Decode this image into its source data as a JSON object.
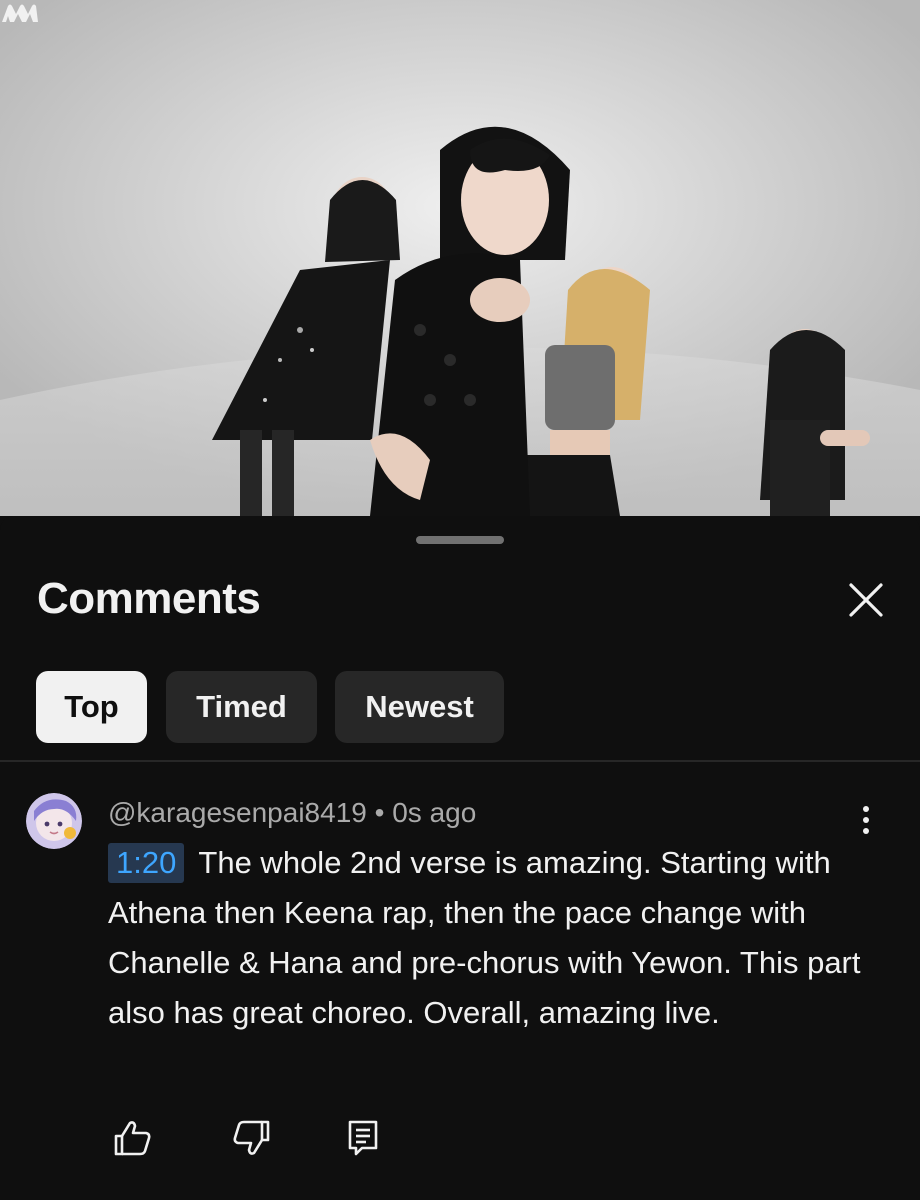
{
  "app": {
    "logo_icon": "youtube-music-style-m-logo"
  },
  "comments_sheet": {
    "title": "Comments",
    "close_icon": "close-icon",
    "tabs": [
      {
        "label": "Top",
        "active": true
      },
      {
        "label": "Timed",
        "active": false
      },
      {
        "label": "Newest",
        "active": false
      }
    ],
    "comment": {
      "author": "@karagesenpai8419",
      "separator": " • ",
      "time_ago": "0s ago",
      "timestamp": "1:20",
      "text": "The whole 2nd verse is amazing. Starting with Athena then Keena rap, then the pace change with Chanelle & Hana and pre-chorus with Yewon. This part also has great choreo. Overall, amazing live.",
      "actions": [
        "like-icon",
        "dislike-icon",
        "reply-icon"
      ],
      "menu_icon": "more-vert-icon"
    }
  },
  "colors": {
    "background": "#0f0f0f",
    "chip_active": "#f1f1f1",
    "chip_inactive": "#272727",
    "timestamp_link": "#3ea6ff",
    "secondary_text": "#aaaaaa"
  }
}
